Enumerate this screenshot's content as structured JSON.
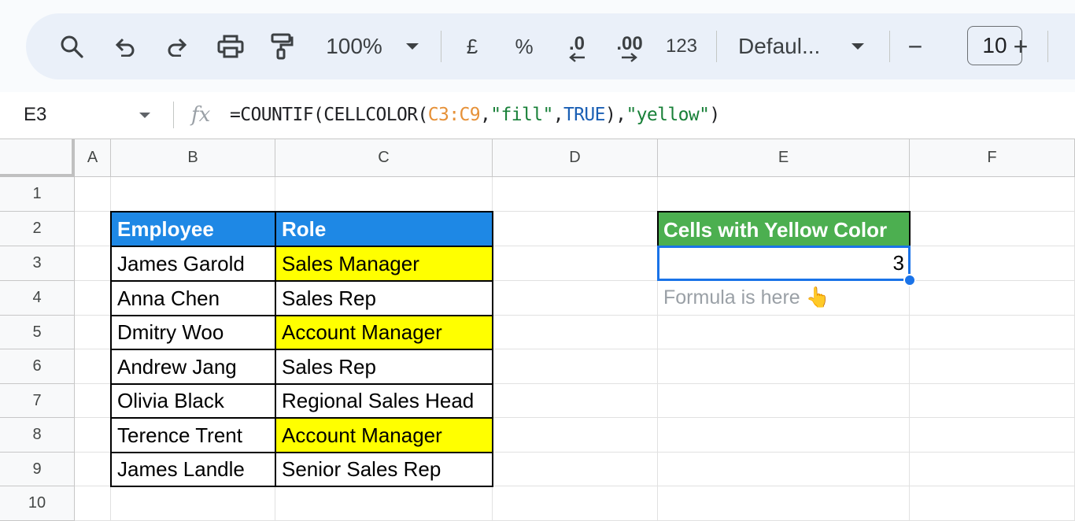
{
  "toolbar": {
    "zoom": "100%",
    "currency": "£",
    "percent": "%",
    "decrease_decimal": ".0",
    "increase_decimal": ".00",
    "number_format": "123",
    "font": "Defaul...",
    "font_size": "10",
    "minus": "−",
    "plus": "+"
  },
  "formula_bar": {
    "cell_ref": "E3",
    "fx": "fx",
    "formula_parts": [
      "=COUNTIF(CELLCOLOR(",
      "C3:C9",
      ",",
      "\"fill\"",
      ",",
      "TRUE",
      "),",
      "\"yellow\"",
      ")"
    ]
  },
  "columns": [
    "A",
    "B",
    "C",
    "D",
    "E",
    "F"
  ],
  "rows": [
    "1",
    "2",
    "3",
    "4",
    "5",
    "6",
    "7",
    "8",
    "9",
    "10"
  ],
  "table": {
    "headers": [
      "Employee",
      "Role"
    ],
    "rows": [
      {
        "employee": "James Garold",
        "role": "Sales Manager",
        "highlight": "yellow"
      },
      {
        "employee": "Anna Chen",
        "role": "Sales Rep",
        "highlight": "none"
      },
      {
        "employee": "Dmitry Woo",
        "role": "Account Manager",
        "highlight": "yellow"
      },
      {
        "employee": "Andrew Jang",
        "role": "Sales Rep",
        "highlight": "none"
      },
      {
        "employee": "Olivia Black",
        "role": "Regional Sales Head",
        "highlight": "none"
      },
      {
        "employee": "Terence Trent",
        "role": "Account Manager",
        "highlight": "yellow"
      },
      {
        "employee": "James Landle",
        "role": "Senior Sales Rep",
        "highlight": "none"
      }
    ]
  },
  "summary": {
    "header": "Cells with Yellow Color",
    "value": "3",
    "note": "Formula is here 👆"
  },
  "colors": {
    "header_blue": "#1e88e5",
    "header_green": "#4caf50",
    "highlight_yellow": "#ffff00",
    "selection": "#1a73e8"
  }
}
